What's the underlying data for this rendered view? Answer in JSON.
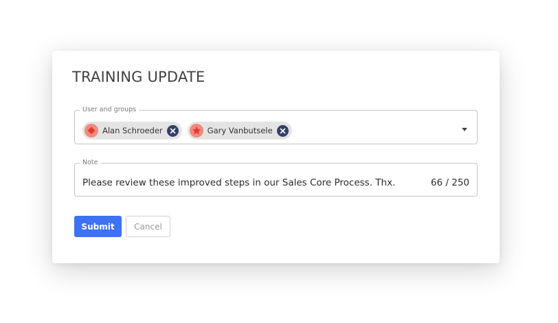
{
  "dialog": {
    "title": "TRAINING UPDATE"
  },
  "users_field": {
    "legend": "User and groups",
    "chips": [
      {
        "label": "Alan Schroeder",
        "avatar_icon": "diamond-icon",
        "avatar_color": "#f28a80"
      },
      {
        "label": "Gary Vanbutsele",
        "avatar_icon": "star-icon",
        "avatar_color": "#f28a80"
      }
    ],
    "dropdown_icon": "chevron-down-icon"
  },
  "note_field": {
    "legend": "Note",
    "value": "Please review these improved steps in our Sales Core Process. Thx.",
    "counter": "66 / 250"
  },
  "actions": {
    "submit_label": "Submit",
    "cancel_label": "Cancel"
  },
  "colors": {
    "primary": "#3d72f2",
    "chip_background": "#e4e4e4",
    "chip_remove": "#32406b",
    "avatar": "#f28a80"
  }
}
